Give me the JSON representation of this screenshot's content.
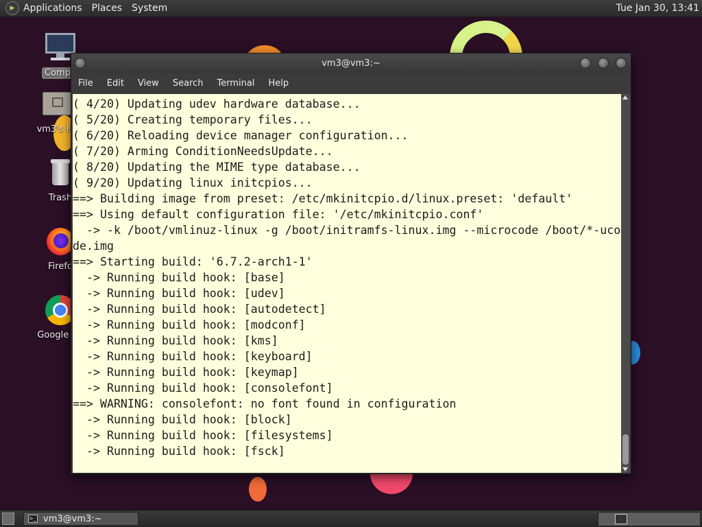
{
  "top_panel": {
    "menus": [
      "Applications",
      "Places",
      "System"
    ],
    "clock": "Tue Jan 30, 13:41"
  },
  "desktop_icons": [
    {
      "label": "Compu",
      "icon": "computer-icon",
      "selected": true
    },
    {
      "label": "vm3's Ho",
      "icon": "home-folder-icon"
    },
    {
      "label": "Trash",
      "icon": "trash-icon"
    },
    {
      "label": "Firefo",
      "icon": "firefox-icon"
    },
    {
      "label": "Google Ch",
      "icon": "chrome-icon"
    }
  ],
  "terminal": {
    "title": "vm3@vm3:~",
    "menu": [
      "File",
      "Edit",
      "View",
      "Search",
      "Terminal",
      "Help"
    ],
    "lines": [
      "( 4/20) Updating udev hardware database...",
      "( 5/20) Creating temporary files...",
      "( 6/20) Reloading device manager configuration...",
      "( 7/20) Arming ConditionNeedsUpdate...",
      "( 8/20) Updating the MIME type database...",
      "( 9/20) Updating linux initcpios...",
      "==> Building image from preset: /etc/mkinitcpio.d/linux.preset: 'default'",
      "==> Using default configuration file: '/etc/mkinitcpio.conf'",
      "  -> -k /boot/vmlinuz-linux -g /boot/initramfs-linux.img --microcode /boot/*-uco",
      "de.img",
      "==> Starting build: '6.7.2-arch1-1'",
      "  -> Running build hook: [base]",
      "  -> Running build hook: [udev]",
      "  -> Running build hook: [autodetect]",
      "  -> Running build hook: [modconf]",
      "  -> Running build hook: [kms]",
      "  -> Running build hook: [keyboard]",
      "  -> Running build hook: [keymap]",
      "  -> Running build hook: [consolefont]",
      "==> WARNING: consolefont: no font found in configuration",
      "  -> Running build hook: [block]",
      "  -> Running build hook: [filesystems]",
      "  -> Running build hook: [fsck]"
    ],
    "background_color": "#ffffdd",
    "text_color": "#1b1b1b"
  },
  "taskbar": {
    "task_label": "vm3@vm3:~",
    "task_icon": "terminal-icon",
    "workspace_icon": "workspace-switcher-icon"
  }
}
